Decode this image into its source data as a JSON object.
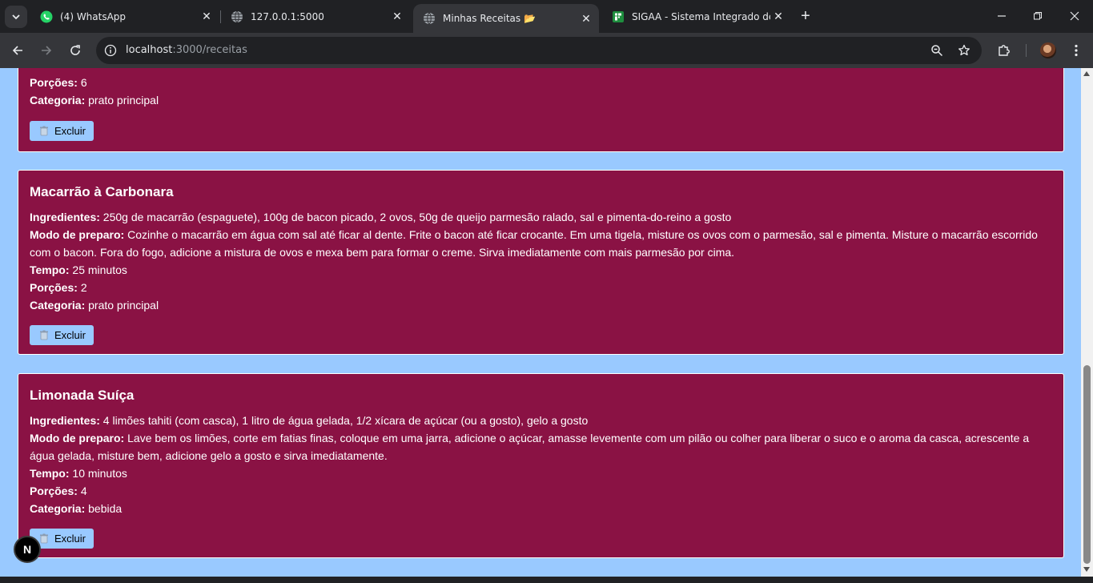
{
  "browser": {
    "tabs": [
      {
        "title": "(4) WhatsApp",
        "favicon": "whatsapp-icon",
        "active": false
      },
      {
        "title": "127.0.0.1:5000",
        "favicon": "globe-icon",
        "active": false
      },
      {
        "title": "Minhas Receitas 📂",
        "favicon": "globe-icon",
        "active": true
      },
      {
        "title": "SIGAA - Sistema Integrado de G",
        "favicon": "sigaa-icon",
        "active": false
      }
    ],
    "url_host": "localhost",
    "url_path": ":3000/receitas",
    "colors": {
      "frame": "#202124",
      "toolbar": "#35363a",
      "text": "#e8eaed"
    }
  },
  "page": {
    "background": "#99c9ff",
    "card_color": "#8a1244",
    "labels": {
      "ingredientes": "Ingredientes:",
      "modo": "Modo de preparo:",
      "tempo": "Tempo:",
      "porcoes": "Porções:",
      "categoria": "Categoria:"
    },
    "delete_label": "Excluir",
    "partial_recipe": {
      "porcoes": "6",
      "categoria": "prato principal"
    },
    "recipes": [
      {
        "name": "Macarrão à Carbonara",
        "ingredientes": "250g de macarrão (espaguete), 100g de bacon picado, 2 ovos, 50g de queijo parmesão ralado, sal e pimenta-do-reino a gosto",
        "modo": "Cozinhe o macarrão em água com sal até ficar al dente. Frite o bacon até ficar crocante. Em uma tigela, misture os ovos com o parmesão, sal e pimenta. Misture o macarrão escorrido com o bacon. Fora do fogo, adicione a mistura de ovos e mexa bem para formar o creme. Sirva imediatamente com mais parmesão por cima.",
        "tempo": "25 minutos",
        "porcoes": "2",
        "categoria": "prato principal"
      },
      {
        "name": "Limonada Suíça",
        "ingredientes": "4 limões tahiti (com casca), 1 litro de água gelada, 1/2 xícara de açúcar (ou a gosto), gelo a gosto",
        "modo": "Lave bem os limões, corte em fatias finas, coloque em uma jarra, adicione o açúcar, amasse levemente com um pilão ou colher para liberar o suco e o aroma da casca, acrescente a água gelada, misture bem, adicione gelo a gosto e sirva imediatamente.",
        "tempo": "10 minutos",
        "porcoes": "4",
        "categoria": "bebida"
      }
    ],
    "dev_badge": "N"
  }
}
